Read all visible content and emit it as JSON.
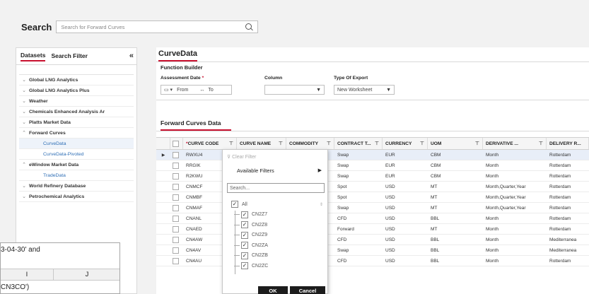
{
  "search": {
    "label": "Search",
    "placeholder": "Search for Forward Curves"
  },
  "sidebar": {
    "tabs": [
      {
        "label": "Datasets"
      },
      {
        "label": "Search Filter"
      }
    ],
    "collapse": "«",
    "items": [
      {
        "label": "Global LNG Analytics",
        "chev": "⌄"
      },
      {
        "label": "Global LNG Analytics Plus",
        "chev": "⌄"
      },
      {
        "label": "Weather",
        "chev": "⌄"
      },
      {
        "label": "Chemicals Enhanced Analysis Ar",
        "chev": "⌄"
      },
      {
        "label": "Platts Market Data",
        "chev": "⌄"
      },
      {
        "label": "Forward Curves",
        "chev": "⌃"
      },
      {
        "label": "CurveData"
      },
      {
        "label": "CurveData-Pivoted"
      },
      {
        "label": "eWindow Market Data",
        "chev": "⌃"
      },
      {
        "label": "TradeData"
      },
      {
        "label": "World Refinery Database",
        "chev": "⌄"
      },
      {
        "label": "Petrochemical Analytics",
        "chev": "⌄"
      }
    ]
  },
  "main": {
    "title": "CurveData",
    "function_builder": {
      "title": "Function Builder",
      "assessment_label": "Assessment Date",
      "required": "*",
      "column_label": "Column",
      "export_label": "Type Of Export",
      "from": "From",
      "to": "To",
      "export_value": "New Worksheet"
    },
    "section_title": "Forward Curves Data"
  },
  "grid": {
    "headers": [
      {
        "label": "CURVE CODE",
        "required": "*"
      },
      {
        "label": "CURVE NAME"
      },
      {
        "label": "COMMODITY"
      },
      {
        "label": "CONTRACT T..."
      },
      {
        "label": "CURRENCY"
      },
      {
        "label": "UOM"
      },
      {
        "label": "DERIVATIVE ..."
      },
      {
        "label": "DELIVERY R..."
      }
    ],
    "rows": [
      {
        "code": "RWXU4",
        "type": "Swap",
        "currency": "EUR",
        "uom": "CBM",
        "derivative": "Month",
        "delivery": "Rotterdam"
      },
      {
        "code": "RRGIK",
        "type": "Swap",
        "currency": "EUR",
        "uom": "CBM",
        "derivative": "Month",
        "delivery": "Rotterdam"
      },
      {
        "code": "R2KWU",
        "type": "Swap",
        "currency": "EUR",
        "uom": "CBM",
        "derivative": "Month",
        "delivery": "Rotterdam"
      },
      {
        "code": "CNMCF",
        "type": "Spot",
        "currency": "USD",
        "uom": "MT",
        "derivative": "Month,Quarter,Year",
        "delivery": "Rotterdam"
      },
      {
        "code": "CNMBF",
        "type": "Spot",
        "currency": "USD",
        "uom": "MT",
        "derivative": "Month,Quarter,Year",
        "delivery": "Rotterdam"
      },
      {
        "code": "CNMAF",
        "type": "Swap",
        "currency": "USD",
        "uom": "MT",
        "derivative": "Month,Quarter,Year",
        "delivery": "Rotterdam"
      },
      {
        "code": "CNANL",
        "type": "CFD",
        "currency": "USD",
        "uom": "BBL",
        "derivative": "Month",
        "delivery": "Rotterdam"
      },
      {
        "code": "CNAED",
        "type": "Forward",
        "currency": "USD",
        "uom": "MT",
        "derivative": "Month",
        "delivery": "Rotterdam"
      },
      {
        "code": "CN4AW",
        "type": "CFD",
        "currency": "USD",
        "uom": "BBL",
        "derivative": "Month",
        "delivery": "Mediterranea"
      },
      {
        "code": "CN4AV",
        "type": "Swap",
        "currency": "USD",
        "uom": "BBL",
        "derivative": "Month",
        "delivery": "Mediterranea"
      },
      {
        "code": "CN4AU",
        "type": "CFD",
        "currency": "USD",
        "uom": "BBL",
        "derivative": "Month",
        "delivery": "Rotterdam"
      }
    ]
  },
  "filter_popup": {
    "clear": "Clear Filter",
    "available": "Available Filters",
    "search_placeholder": "Search...",
    "all": "All",
    "items": [
      "CN2Z7",
      "CN2Z8",
      "CN2Z9",
      "CN2ZA",
      "CN2ZB",
      "CN2ZC"
    ],
    "ok": "OK",
    "cancel": "Cancel"
  },
  "excel": {
    "line1": "3-04-30' and",
    "col_i": "I",
    "col_j": "J",
    "line2": "CN3CO')"
  }
}
